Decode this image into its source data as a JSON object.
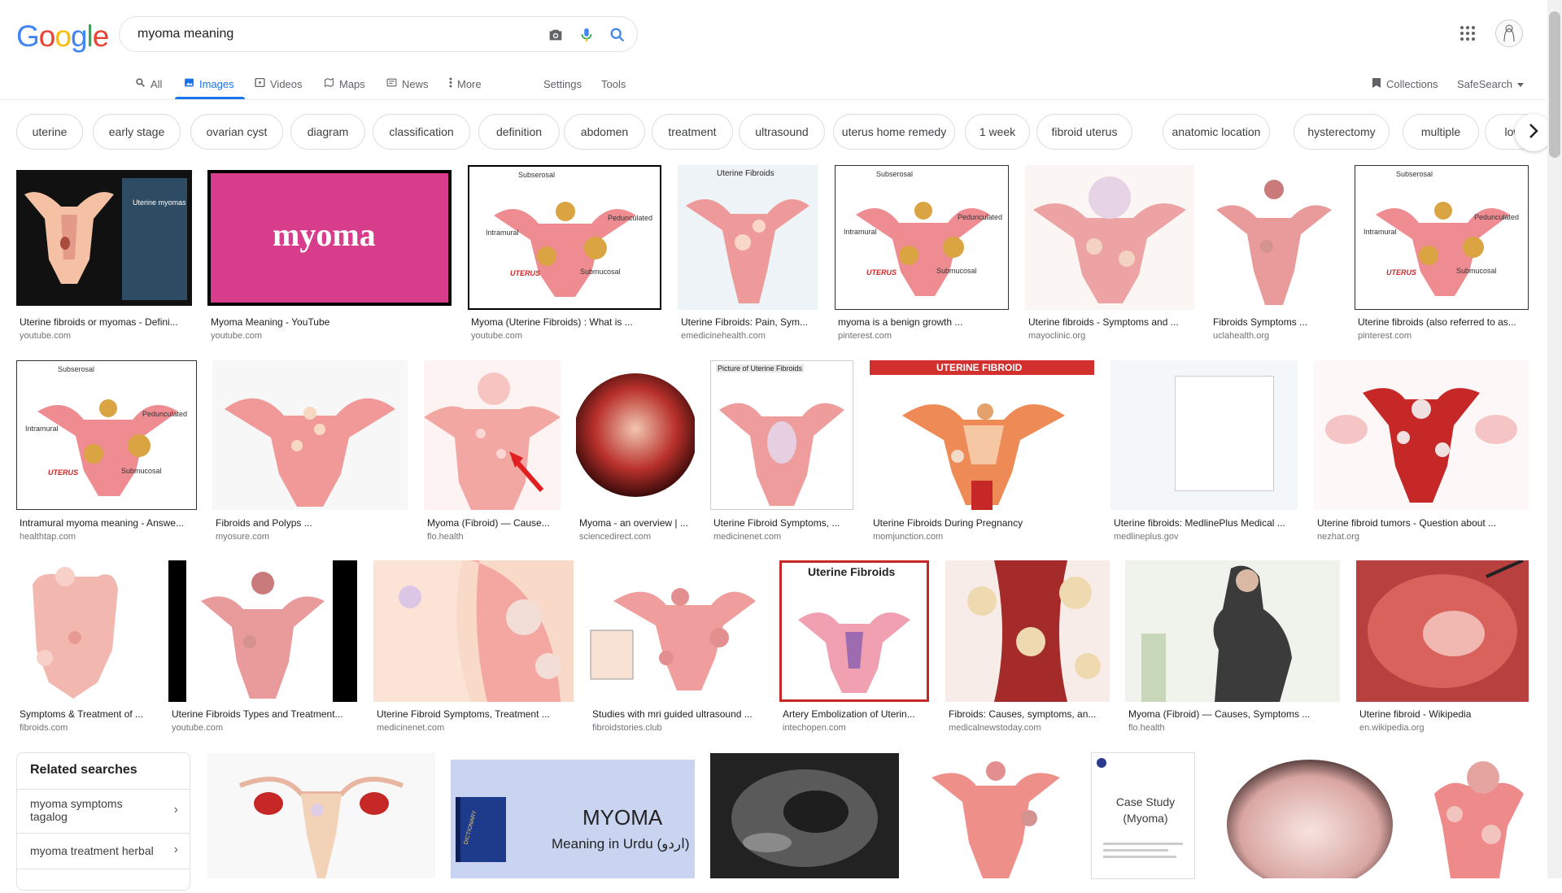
{
  "logo": [
    "G",
    "o",
    "o",
    "g",
    "l",
    "e"
  ],
  "logo_colors": [
    "#4285F4",
    "#EA4335",
    "#FBBC05",
    "#4285F4",
    "#34A853",
    "#EA4335"
  ],
  "search": {
    "query": "myoma meaning"
  },
  "tabs": {
    "all": "All",
    "images": "Images",
    "videos": "Videos",
    "maps": "Maps",
    "news": "News",
    "more": "More",
    "settings": "Settings",
    "tools": "Tools",
    "collections": "Collections",
    "safesearch": "SafeSearch"
  },
  "chips": [
    "uterine",
    "early stage",
    "ovarian cyst",
    "diagram",
    "classification",
    "definition",
    "abdomen",
    "treatment",
    "ultrasound",
    "uterus home remedy",
    "1 week",
    "fibroid uterus",
    "anatomic location",
    "hysterectomy",
    "multiple",
    "low"
  ],
  "results": [
    {
      "caption": "Uterine fibroids or myomas - Defini...",
      "source": "youtube.com"
    },
    {
      "caption": "Myoma Meaning - YouTube",
      "source": "youtube.com"
    },
    {
      "caption": "Myoma (Uterine Fibroids) : What is ...",
      "source": "youtube.com"
    },
    {
      "caption": "Uterine Fibroids: Pain, Sym...",
      "source": "emedicinehealth.com"
    },
    {
      "caption": "myoma is a benign growth ...",
      "source": "pinterest.com"
    },
    {
      "caption": "Uterine fibroids - Symptoms and ...",
      "source": "mayoclinic.org"
    },
    {
      "caption": "Fibroids Symptoms ...",
      "source": "uclahealth.org"
    },
    {
      "caption": "Uterine fibroids (also referred to as...",
      "source": "pinterest.com"
    },
    {
      "caption": "Intramural myoma meaning - Answe...",
      "source": "healthtap.com"
    },
    {
      "caption": "Fibroids and Polyps ...",
      "source": "myosure.com"
    },
    {
      "caption": "Myoma (Fibroid) — Cause...",
      "source": "flo.health"
    },
    {
      "caption": "Myoma - an overview | ...",
      "source": "sciencedirect.com"
    },
    {
      "caption": "Uterine Fibroid Symptoms, ...",
      "source": "medicinenet.com"
    },
    {
      "caption": "Uterine Fibroids During Pregnancy",
      "source": "momjunction.com"
    },
    {
      "caption": "Uterine fibroids: MedlinePlus Medical ...",
      "source": "medlineplus.gov"
    },
    {
      "caption": "Uterine fibroid tumors - Question about ...",
      "source": "nezhat.org"
    },
    {
      "caption": "Symptoms & Treatment of ...",
      "source": "fibroids.com"
    },
    {
      "caption": "Uterine Fibroids Types and Treatment...",
      "source": "youtube.com"
    },
    {
      "caption": "Uterine Fibroid Symptoms, Treatment ...",
      "source": "medicinenet.com"
    },
    {
      "caption": "Studies with mri guided ultrasound ...",
      "source": "fibroidstories.club"
    },
    {
      "caption": "Artery Embolization of Uterin...",
      "source": "intechopen.com"
    },
    {
      "caption": "Fibroids: Causes, symptoms, an...",
      "source": "medicalnewstoday.com"
    },
    {
      "caption": "Myoma (Fibroid) — Causes, Symptoms ...",
      "source": "flo.health"
    },
    {
      "caption": "Uterine fibroid - Wikipedia",
      "source": "en.wikipedia.org"
    }
  ],
  "thumb_text": {
    "myoma_word": "myoma",
    "uterine_myomas": "Uterine myomas",
    "subserosal": "Subserosal",
    "pedunculated": "Pedunculated",
    "intramural": "Intramural",
    "submucosal": "Submucosal",
    "uterus": "UTERUS",
    "uterine_fibroids": "Uterine Fibroids",
    "uterine_fibroid_banner": "UTERINE FIBROID",
    "picture_of": "Picture of Uterine Fibroids",
    "dict_title": "MYOMA",
    "dict_sub": "Meaning in Urdu (اردو)",
    "dictionary": "DICTIONARY",
    "case_study": "Case Study (Myoma)"
  },
  "related": {
    "title": "Related searches",
    "items": [
      "myoma symptoms tagalog",
      "myoma treatment herbal"
    ]
  },
  "colors": {
    "accent": "#1a73e8",
    "uterus_pink": "#e57373",
    "fibroid_yellow": "#d9a441"
  }
}
